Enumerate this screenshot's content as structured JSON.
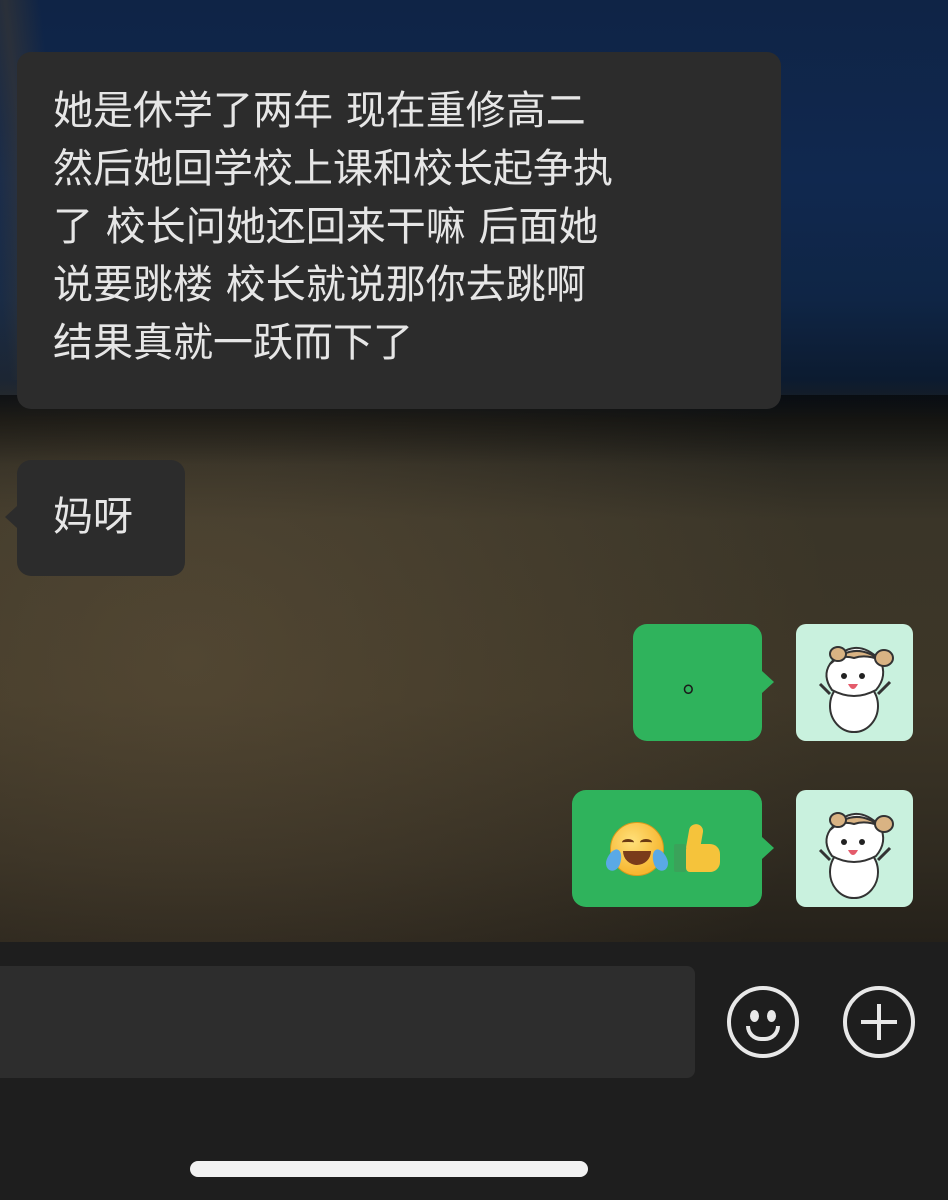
{
  "chat": {
    "messages": [
      {
        "sender": "other",
        "lines": [
          "她是休学了两年 现在重修高二",
          "然后她回学校上课和校长起争执",
          "了 校长问她还回来干嘛 后面她",
          "说要跳楼 校长就说那你去跳啊",
          "结果真就一跃而下了"
        ]
      },
      {
        "sender": "other",
        "text": "妈呀"
      },
      {
        "sender": "me",
        "text": "。",
        "avatar": "puppy-sticker-avatar"
      },
      {
        "sender": "me",
        "emojis": [
          "laughing-crying-emoji",
          "thumbs-up-emoji"
        ],
        "avatar": "puppy-sticker-avatar"
      }
    ]
  },
  "colors": {
    "incoming_bubble": "#2c2c2c",
    "outgoing_bubble": "#2fb35c",
    "input_bar": "#1e1e1e"
  },
  "input_bar": {
    "icons": [
      "emoji-face-icon",
      "plus-icon"
    ]
  }
}
